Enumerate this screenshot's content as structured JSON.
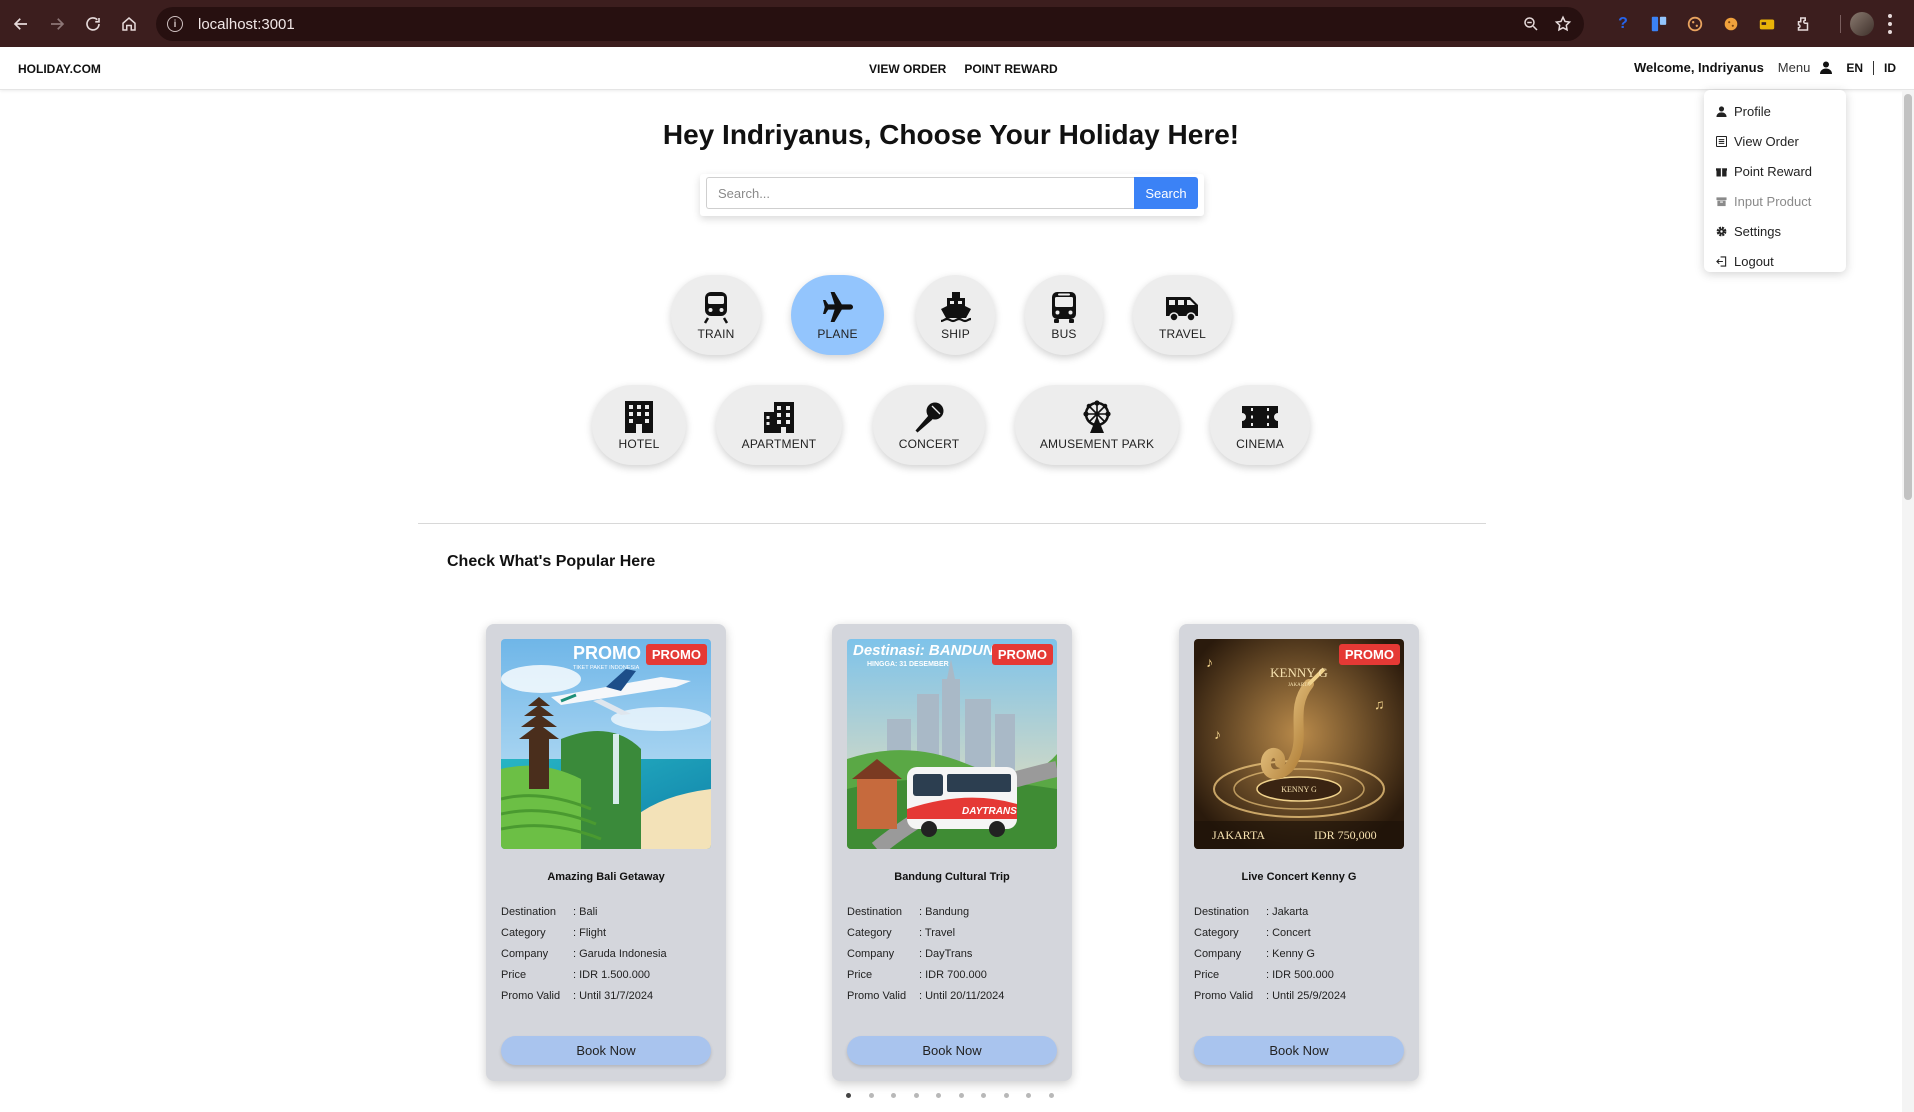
{
  "browser": {
    "url": "localhost:3001"
  },
  "navbar": {
    "brand": "HOLIDAY.COM",
    "links": [
      "VIEW ORDER",
      "POINT REWARD"
    ],
    "welcome": "Welcome, Indriyanus",
    "menu_label": "Menu",
    "lang_en": "EN",
    "lang_id": "ID"
  },
  "dropdown": {
    "items": [
      {
        "label": "Profile",
        "icon": "user-icon"
      },
      {
        "label": "View Order",
        "icon": "list-icon"
      },
      {
        "label": "Point Reward",
        "icon": "gift-icon"
      },
      {
        "label": "Input Product",
        "icon": "box-icon",
        "disabled": true
      },
      {
        "label": "Settings",
        "icon": "gear-icon"
      },
      {
        "label": "Logout",
        "icon": "logout-icon"
      }
    ]
  },
  "hero": {
    "title": "Hey Indriyanus, Choose Your Holiday Here!",
    "search_placeholder": "Search...",
    "search_button": "Search"
  },
  "categories": [
    {
      "label": "TRAIN",
      "icon": "train-icon"
    },
    {
      "label": "PLANE",
      "icon": "plane-icon",
      "active": true
    },
    {
      "label": "SHIP",
      "icon": "ship-icon"
    },
    {
      "label": "BUS",
      "icon": "bus-icon"
    },
    {
      "label": "TRAVEL",
      "icon": "van-icon"
    },
    {
      "label": "HOTEL",
      "icon": "hotel-icon"
    },
    {
      "label": "APARTMENT",
      "icon": "apartment-icon"
    },
    {
      "label": "CONCERT",
      "icon": "microphone-icon"
    },
    {
      "label": "AMUSEMENT PARK",
      "icon": "ferris-wheel-icon"
    },
    {
      "label": "CINEMA",
      "icon": "ticket-icon"
    }
  ],
  "popular": {
    "title": "Check What's Popular Here",
    "detail_labels": [
      "Destination",
      "Category",
      "Company",
      "Price",
      "Promo Valid"
    ],
    "cards": [
      {
        "badge": "PROMO",
        "title": "Amazing Bali Getaway",
        "details": [
          ": Bali",
          ": Flight",
          ": Garuda Indonesia",
          ": IDR 1.500.000",
          ": Until 31/7/2024"
        ],
        "button": "Book Now",
        "image_text": [
          "PROMO",
          "TIKET PAKET INDONESIA"
        ]
      },
      {
        "badge": "PROMO",
        "title": "Bandung Cultural Trip",
        "details": [
          ": Bandung",
          ": Travel",
          ": DayTrans",
          ": IDR 700.000",
          ": Until 20/11/2024"
        ],
        "button": "Book Now",
        "image_text": [
          "Destinasi: BANDUNG",
          "HINGGA: 31 DESEMBER",
          "DAYTRANS"
        ]
      },
      {
        "badge": "PROMO",
        "title": "Live Concert Kenny G",
        "details": [
          ": Jakarta",
          ": Concert",
          ": Kenny G",
          ": IDR 500.000",
          ": Until 25/9/2024"
        ],
        "button": "Book Now",
        "image_text": [
          "KENNY G",
          "JAKARTA",
          "KENNY G",
          "JAKARTA",
          "IDR 750,000"
        ]
      }
    ]
  },
  "carousel": {
    "total": 10,
    "active_index": 0
  },
  "colors": {
    "accent": "#3b82f6",
    "active_category": "#93c5fd",
    "promo": "#e53935",
    "chrome": "#3c1e1e"
  }
}
